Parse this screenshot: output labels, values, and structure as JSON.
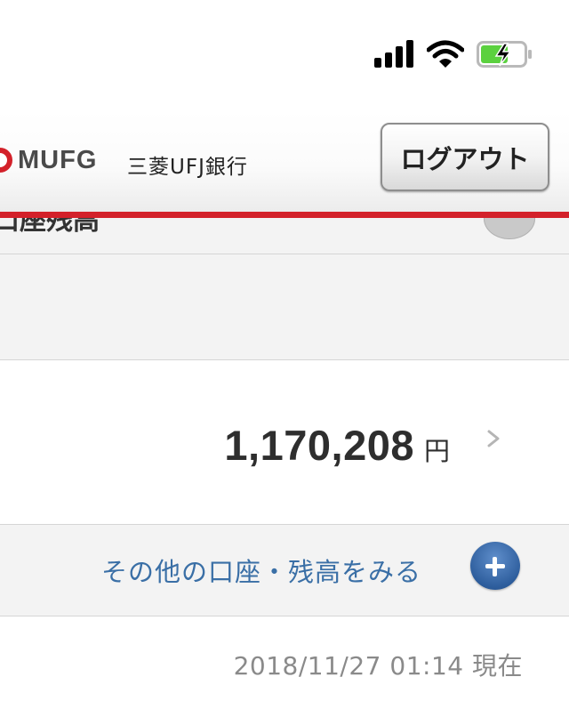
{
  "header": {
    "logo_text": "MUFG",
    "bank_name": "三菱UFJ銀行",
    "logout_label": "ログアウト"
  },
  "section": {
    "title_partial": "口座残高"
  },
  "balance": {
    "amount": "1,170,208",
    "currency": "円"
  },
  "more": {
    "label": "その他の口座・残高をみる"
  },
  "timestamp": "2018/11/27 01:14 現在",
  "colors": {
    "brand_red": "#d3212a",
    "link_blue": "#3a6fa6",
    "plus_blue": "#2e5e9d",
    "battery_green": "#5bd13f"
  },
  "icons": {
    "signal": "cellular-signal-icon",
    "wifi": "wifi-icon",
    "battery": "battery-charging-icon",
    "chevron": "chevron-right-icon",
    "plus": "plus-circle-icon"
  }
}
